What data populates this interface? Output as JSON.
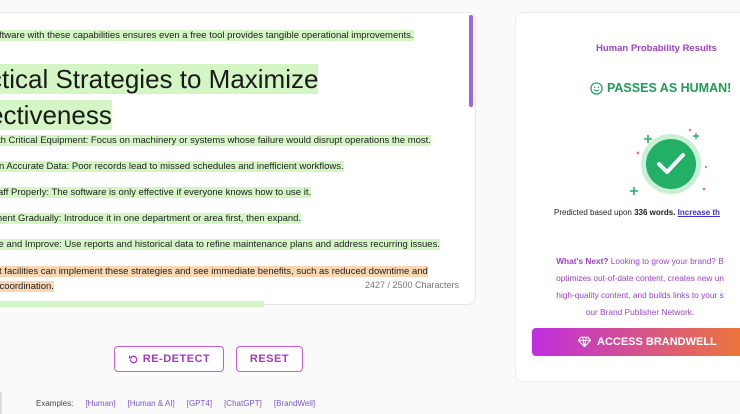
{
  "editor": {
    "lines": [
      "software with these capabilities ensures even a free tool provides tangible operational improvements.",
      "with Critical Equipment: Focus on machinery or systems whose failure would disrupt operations the most.",
      "tain Accurate Data: Poor records lead to missed schedules and inefficient workflows.",
      "Staff Properly: The software is only effective if everyone knows how to use it.",
      "ement Gradually: Introduce it in one department or area first, then expand.",
      "yze and Improve: Use reports and historical data to refine maintenance plans and address recurring issues.",
      "est facilities can implement these strategies and see immediate benefits, such as reduced downtime and",
      "m coordination."
    ],
    "heading_line1": "ctical Strategies to Maximize",
    "heading_line2": "ectiveness",
    "char_count": "2427 / 2500 Characters"
  },
  "actions": {
    "redetect_label": "RE-DETECT",
    "reset_label": "RESET"
  },
  "examples": {
    "label": "Examples:",
    "items": [
      "[Human]",
      "[Human & AI]",
      "[GPT4]",
      "[ChatGPT]",
      "[BrandWell]"
    ]
  },
  "result": {
    "title": "Human Probability Results",
    "verdict": "PASSES AS HUMAN!",
    "predicted_prefix": "Predicted based upon",
    "word_count": "336 words.",
    "increase_link": "Increase th",
    "next_lines": [
      {
        "bold": "What's Next?",
        "text": " Looking to grow your brand? B"
      },
      {
        "bold": "",
        "text": "optimizes out-of-date content, creates new un"
      },
      {
        "bold": "",
        "text": "high-quality content, and builds links to your s"
      },
      {
        "bold": "",
        "text": "our Brand Publisher Network."
      }
    ],
    "access_label": "ACCESS BRANDWELL"
  },
  "colors": {
    "accent_purple": "#9b43c9",
    "pass_green": "#1f9c57",
    "highlight_green": "#d4f5c4",
    "highlight_orange": "#fad7b2"
  }
}
